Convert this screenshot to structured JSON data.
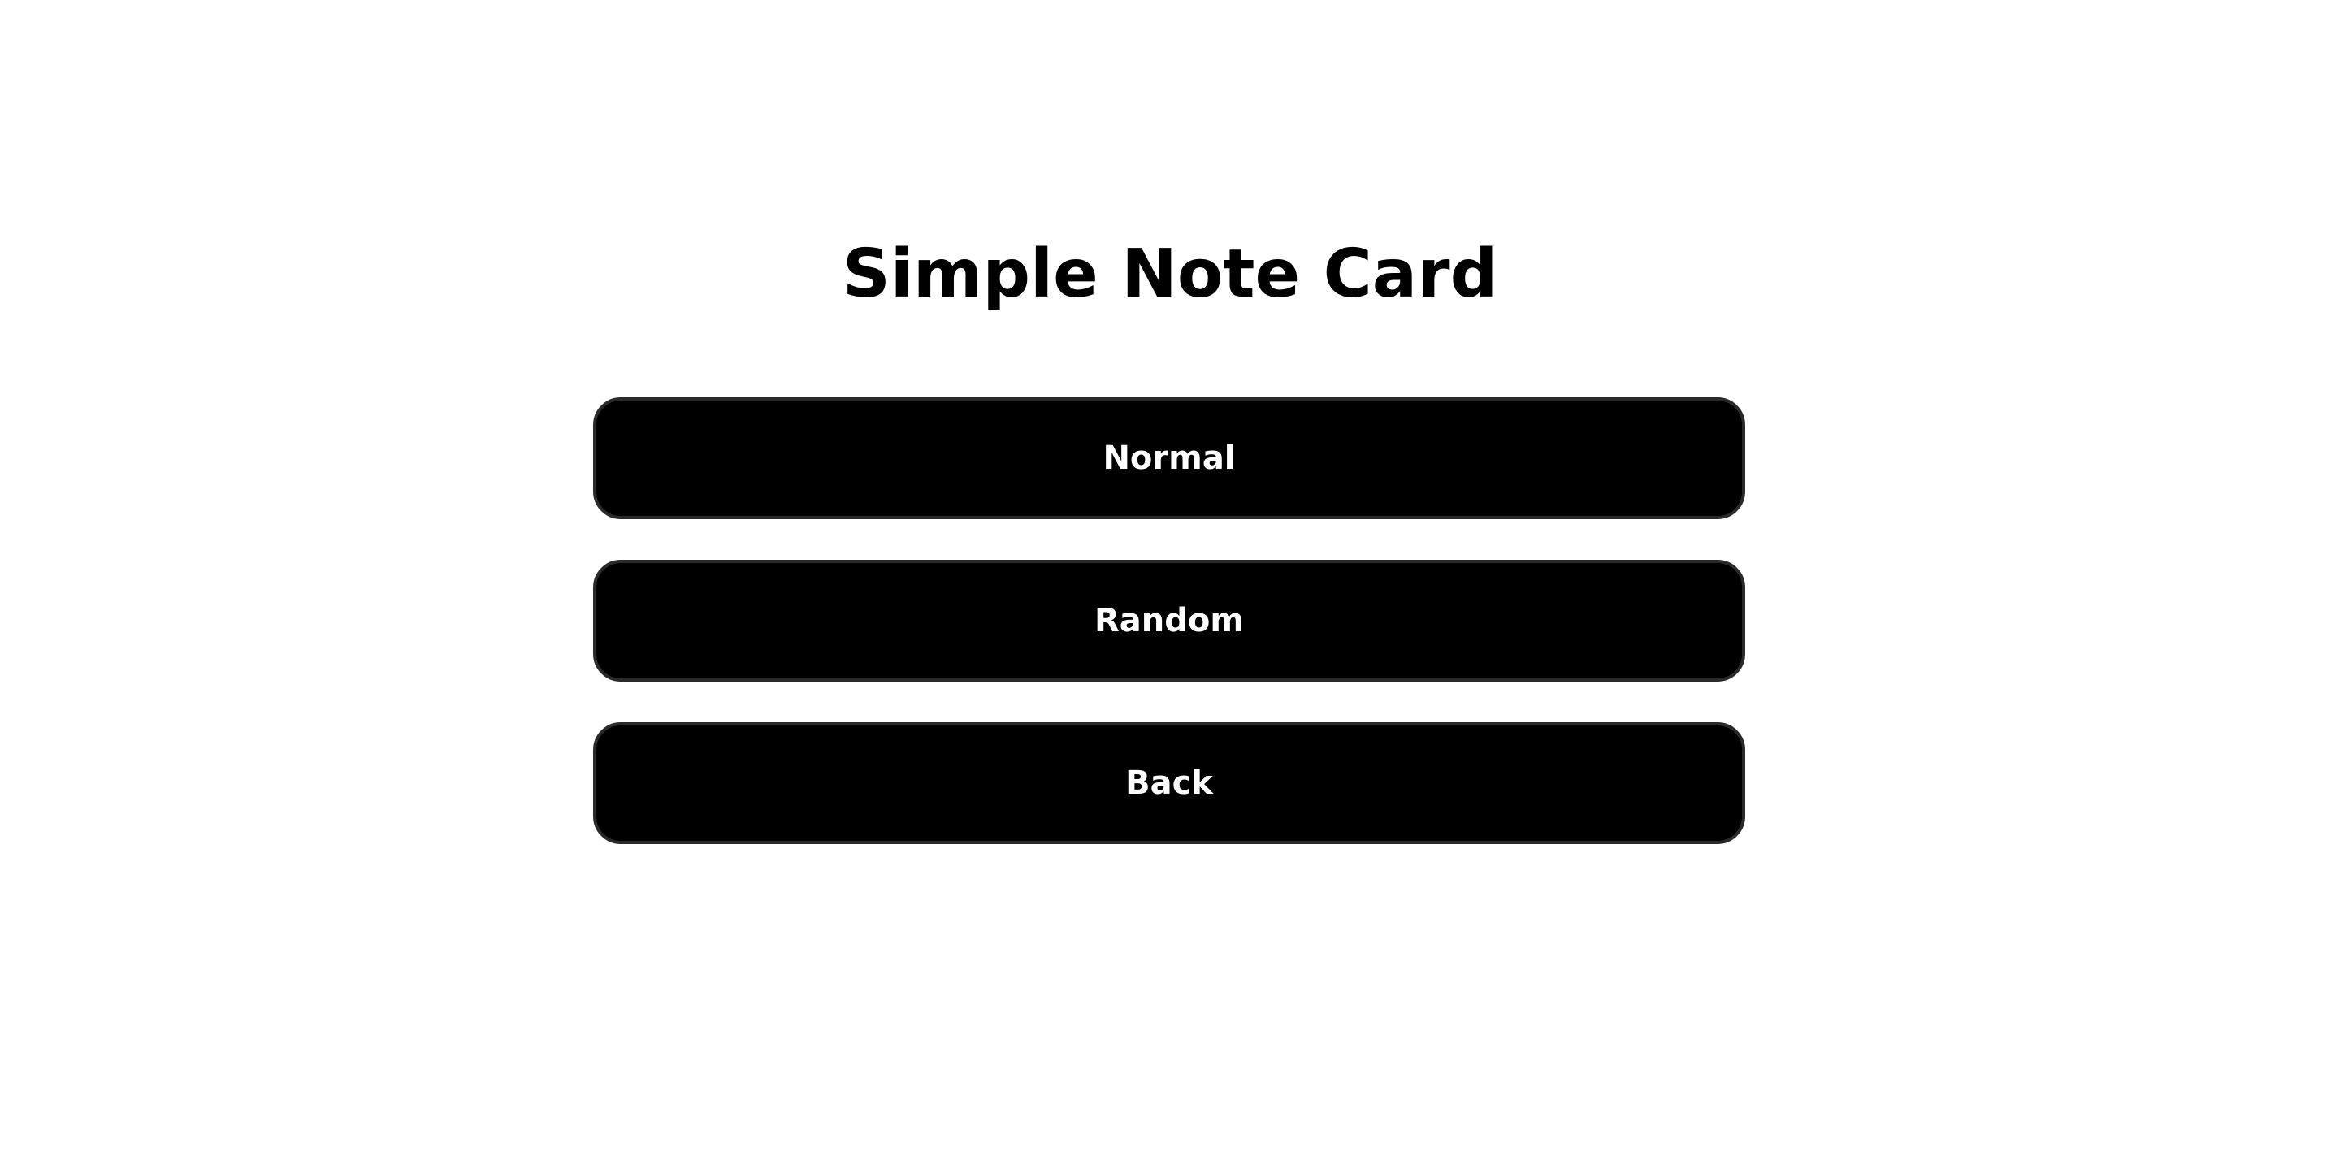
{
  "header": {
    "title": "Simple Note Card"
  },
  "menu": {
    "buttons": [
      {
        "label": "Normal"
      },
      {
        "label": "Random"
      },
      {
        "label": "Back"
      }
    ]
  },
  "colors": {
    "background": "#ffffff",
    "button_bg": "#000000",
    "button_text": "#ffffff",
    "title_text": "#000000"
  }
}
